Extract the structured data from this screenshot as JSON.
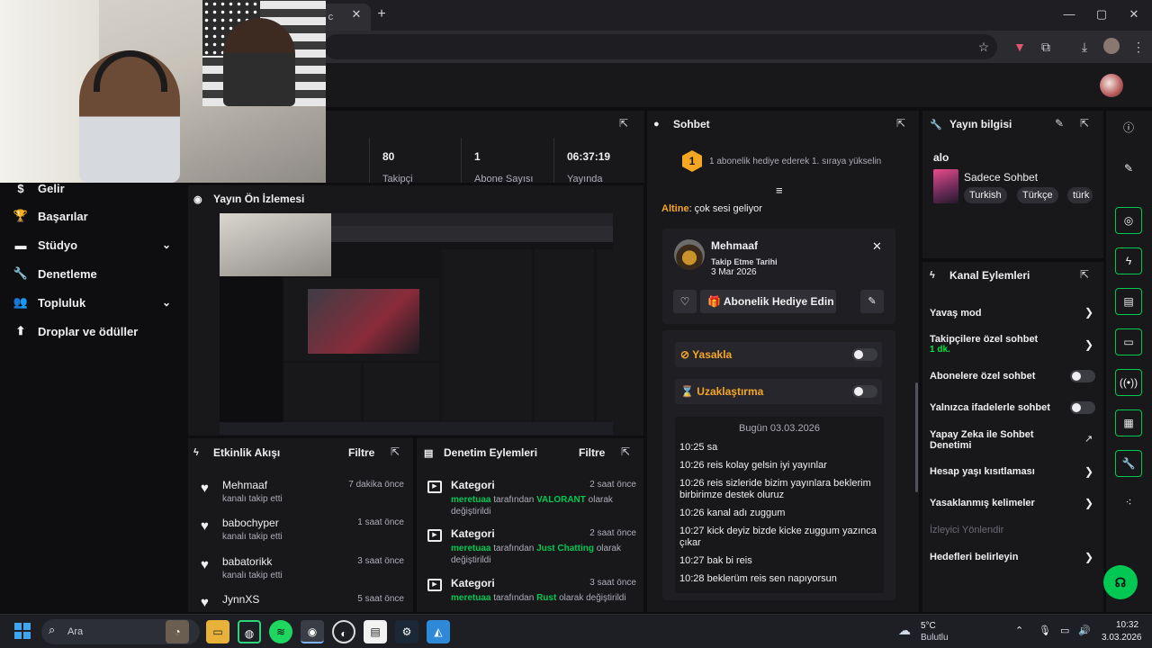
{
  "browser": {
    "tab_title": "ve c",
    "tab_close": "✕",
    "new_tab": "+",
    "minimize": "—",
    "maximize": "▢",
    "close": "✕"
  },
  "nav": {
    "items": [
      {
        "label": "Gelir",
        "icon": "dollar-icon",
        "glyph": "$"
      },
      {
        "label": "Başarılar",
        "icon": "trophy-icon",
        "glyph": "🏆"
      },
      {
        "label": "Stüdyo",
        "icon": "studio-icon",
        "glyph": "▬"
      },
      {
        "label": "Denetleme",
        "icon": "wrench-icon",
        "glyph": "🔧"
      },
      {
        "label": "Topluluk",
        "icon": "community-icon",
        "glyph": "👥"
      },
      {
        "label": "Droplar ve ödüller",
        "icon": "drops-icon",
        "glyph": "⬆"
      }
    ],
    "chevron": "⌄"
  },
  "stats": {
    "items": [
      {
        "value": "80",
        "label": "Takipçi"
      },
      {
        "value": "1",
        "label": "Abone Sayısı"
      },
      {
        "value": "06:37:19",
        "label": "Yayında"
      }
    ]
  },
  "preview": {
    "title": "Yayın Ön İzlemesi"
  },
  "activity": {
    "title": "Etkinlik Akışı",
    "filter": "Filtre",
    "items": [
      {
        "name": "Mehmaaf",
        "action": "kanalı takip etti",
        "time": "7 dakika önce"
      },
      {
        "name": "babochyper",
        "action": "kanalı takip etti",
        "time": "1 saat önce"
      },
      {
        "name": "babatorikk",
        "action": "kanalı takip etti",
        "time": "3 saat önce"
      },
      {
        "name": "JynnXS",
        "action": "",
        "time": "5 saat önce"
      }
    ]
  },
  "moderation": {
    "title": "Denetim Eylemleri",
    "filter": "Filtre",
    "items": [
      {
        "title": "Kategori",
        "time": "2 saat önce",
        "user": "meretuaa",
        "mid": "tarafından",
        "target": "VALORANT",
        "end": "olarak değiştirildi"
      },
      {
        "title": "Kategori",
        "time": "2 saat önce",
        "user": "meretuaa",
        "mid": "tarafından",
        "target": "Just Chatting",
        "end": "olarak değiştirildi"
      },
      {
        "title": "Kategori",
        "time": "3 saat önce",
        "user": "meretuaa",
        "mid": "tarafından",
        "target": "Rust",
        "end": "olarak değiştirildi"
      }
    ]
  },
  "chat": {
    "title": "Sohbet",
    "sub_badge": "1",
    "sub_banner": "1 abonelik hediye ederek 1. sıraya yükselin",
    "message_user": "Altine",
    "message_text": ": çok sesi geliyor",
    "user_card": {
      "name": "Mehmaaf",
      "follow_label": "Takip Etme Tarihi",
      "follow_date": "3 Mar 2026",
      "gift_label": "Abonelik Hediye Edin"
    },
    "ban_label": "Yasakla",
    "timeout_label": "Uzaklaştırma",
    "history_date": "Bugün 03.03.2026",
    "history": [
      "10:25 sa",
      "10:26 reis kolay gelsin iyi yayınlar",
      "10:26 reis sizleride bizim yayınlara beklerim birbirimze destek oluruz",
      "10:26 kanal adı zuggum",
      "10:27 kick deyiz bizde kicke zuggum yazınca çıkar",
      "10:27 bak bi reis",
      "10:28 beklerüm reis sen napıyorsun"
    ]
  },
  "info": {
    "title": "Yayın bilgisi",
    "stream_title": "alo",
    "category": "Sadece Sohbet",
    "tags": [
      "Turkish",
      "Türkçe",
      "türk"
    ]
  },
  "channel_actions": {
    "title": "Kanal Eylemleri",
    "slow": "Yavaş mod",
    "followers": "Takipçilere özel sohbet",
    "followers_sub": "1 dk.",
    "subs": "Abonelere özel sohbet",
    "emotes": "Yalnızca ifadelerle sohbet",
    "ai": "Yapay Zeka ile Sohbet Denetimi",
    "age": "Hesap yaşı kısıtlaması",
    "banned_words": "Yasaklanmış kelimeler",
    "guide": "İzleyici Yönlendir",
    "goals": "Hedefleri belirleyin"
  },
  "taskbar": {
    "search": "Ara",
    "weather_temp": "5°C",
    "weather_desc": "Bulutlu",
    "time": "10:32",
    "date": "3.03.2026"
  },
  "colors": {
    "accent": "#00c853",
    "warning": "#f5a623",
    "panel": "#18181b",
    "background": "#0e0e10"
  }
}
